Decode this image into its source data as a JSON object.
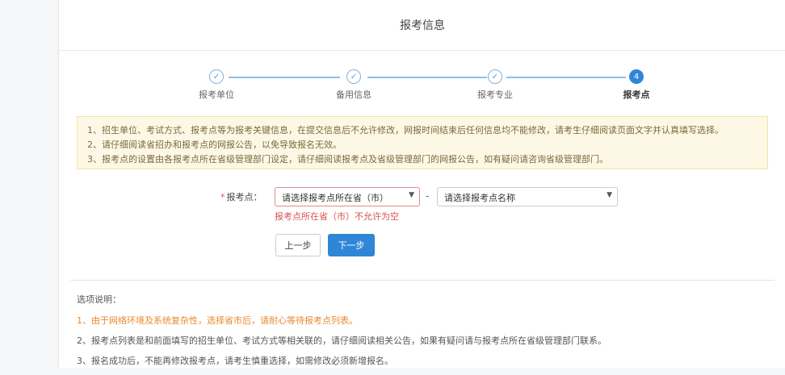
{
  "header": {
    "title": "报考信息"
  },
  "steps": [
    {
      "label": "报考单位",
      "state": "done",
      "icon": "check-icon"
    },
    {
      "label": "备用信息",
      "state": "done",
      "icon": "check-icon"
    },
    {
      "label": "报考专业",
      "state": "done",
      "icon": "check-icon"
    },
    {
      "label": "报考点",
      "state": "active",
      "number": "4"
    }
  ],
  "notice": {
    "lines": [
      "1、招生单位、考试方式、报考点等为报考关键信息，在提交信息后不允许修改，网报时间结束后任何信息均不能修改，请考生仔细阅读页面文字并认真填写选择。",
      "2、请仔细阅读省招办和报考点的网报公告，以免导致报名无效。",
      "3、报考点的设置由各报考点所在省级管理部门设定，请仔细阅读报考点及省级管理部门的网报公告，如有疑问请咨询省级管理部门。"
    ]
  },
  "form": {
    "required_mark": "*",
    "label": "报考点：",
    "province_select": "请选择报考点所在省（市）",
    "site_select": "请选择报考点名称",
    "separator": "-",
    "error": "报考点所在省（市）不允许为空"
  },
  "buttons": {
    "prev": "上一步",
    "next": "下一步"
  },
  "notes": {
    "title": "选项说明：",
    "items": [
      "1、由于网络环境及系统复杂性，选择省市后，请耐心等待报考点列表。",
      "2、报考点列表是和前面填写的招生单位、考试方式等相关联的，请仔细阅读相关公告，如果有疑问请与报考点所在省级管理部门联系。",
      "3、报名成功后，不能再修改报考点，请考生慎重选择，如需修改必须新增报名。"
    ]
  },
  "colors": {
    "accent": "#2f86d6",
    "error": "#d9534f",
    "warning_text": "#e8892e",
    "notice_bg": "#fdf8e6"
  }
}
